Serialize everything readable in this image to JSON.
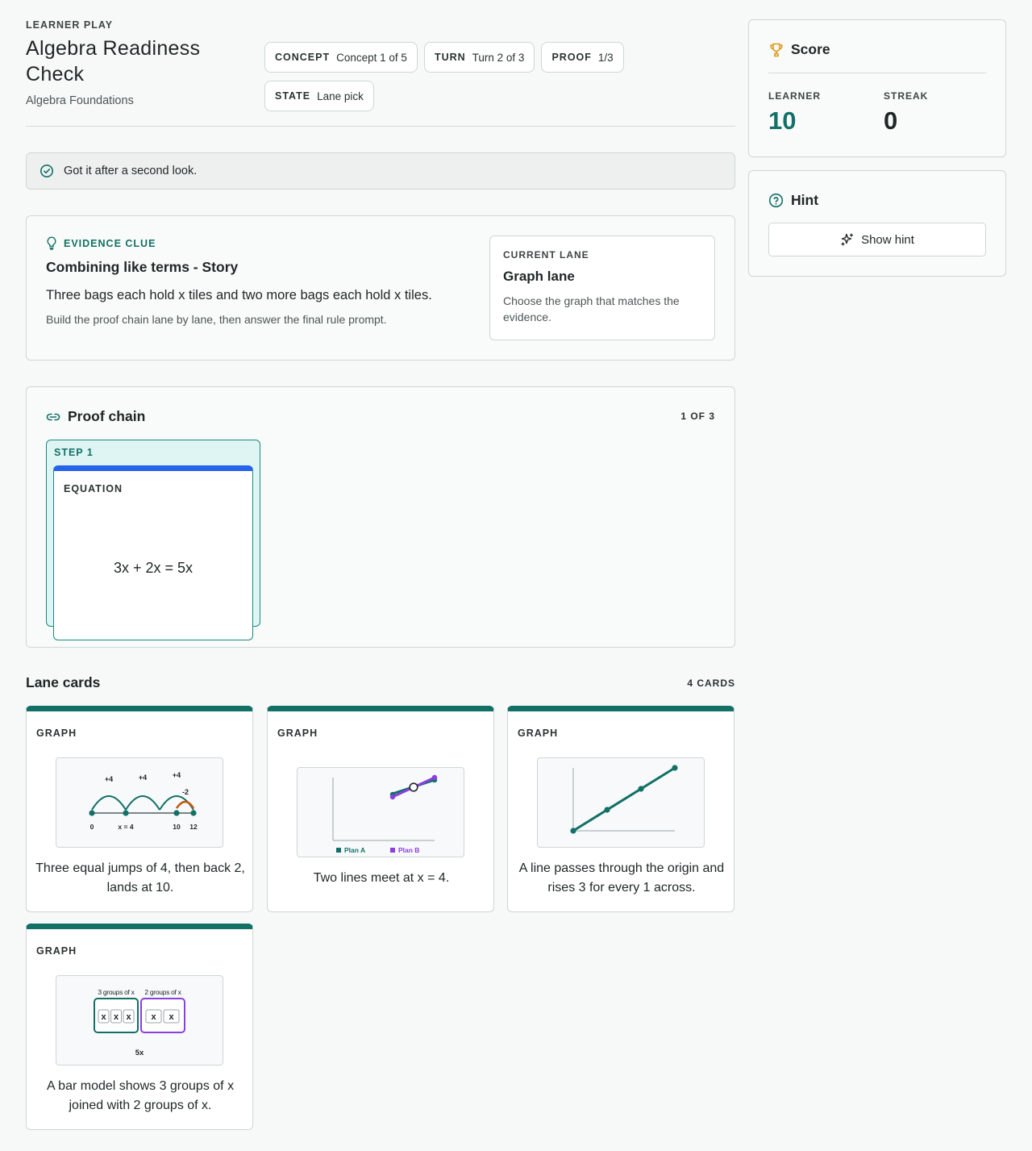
{
  "header": {
    "eyebrow": "LEARNER PLAY",
    "title": "Algebra Readiness Check",
    "subtitle": "Algebra Foundations",
    "chips": [
      {
        "key": "CONCEPT",
        "value": "Concept 1 of 5"
      },
      {
        "key": "TURN",
        "value": "Turn 2 of 3"
      },
      {
        "key": "PROOF",
        "value": "1/3"
      },
      {
        "key": "STATE",
        "value": "Lane pick"
      }
    ]
  },
  "feedback": {
    "text": "Got it after a second look.",
    "icon": "check-circle-icon"
  },
  "clue": {
    "eyebrow": "EVIDENCE CLUE",
    "title": "Combining like terms - Story",
    "text": "Three bags each hold x tiles and two more bags each hold x tiles.",
    "sub": "Build the proof chain lane by lane, then answer the final rule prompt.",
    "lane": {
      "eyebrow": "CURRENT LANE",
      "name": "Graph lane",
      "desc": "Choose the graph that matches the evidence."
    }
  },
  "proof": {
    "title": "Proof chain",
    "count": "1 OF 3",
    "step": {
      "label": "STEP 1",
      "card_type": "EQUATION",
      "equation": "3x + 2x = 5x",
      "accent": "#2563eb"
    }
  },
  "lane_cards": {
    "title": "Lane cards",
    "count": "4 CARDS",
    "cards": [
      {
        "type": "GRAPH",
        "caption": "Three equal jumps of 4, then back 2, lands at 10.",
        "figure": {
          "jumps": [
            "+4",
            "+4",
            "+4"
          ],
          "back": "-2",
          "ticks": [
            "0",
            "x = 4",
            "10",
            "12"
          ]
        }
      },
      {
        "type": "GRAPH",
        "caption": "Two lines meet at x = 4.",
        "figure": {
          "legend": [
            "Plan A",
            "Plan B"
          ],
          "colors": [
            "#127066",
            "#8b3fe0"
          ]
        }
      },
      {
        "type": "GRAPH",
        "caption": "A line passes through the origin and rises 3 for every 1 across."
      },
      {
        "type": "GRAPH",
        "caption": "A bar model shows 3 groups of x joined with 2 groups of x.",
        "figure": {
          "left_label": "3 groups of x",
          "right_label": "2 groups of x",
          "total": "5x"
        }
      }
    ]
  },
  "score": {
    "title": "Score",
    "learner_label": "LEARNER",
    "learner_value": "10",
    "streak_label": "STREAK",
    "streak_value": "0"
  },
  "hint": {
    "title": "Hint",
    "button": "Show hint"
  },
  "colors": {
    "teal": "#127066",
    "accent_blue": "#2563eb",
    "purple": "#8b3fe0",
    "orange": "#c2570c",
    "trophy": "#d99a1a"
  }
}
